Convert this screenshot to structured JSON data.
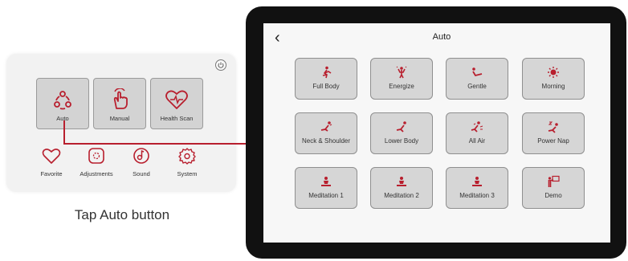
{
  "remote": {
    "buttons": [
      {
        "label": "Auto"
      },
      {
        "label": "Manual"
      },
      {
        "label": "Health Scan"
      }
    ],
    "icons": [
      {
        "label": "Favorite"
      },
      {
        "label": "Adjustments"
      },
      {
        "label": "Sound"
      },
      {
        "label": "System"
      }
    ],
    "caption": "Tap Auto button"
  },
  "tablet": {
    "back_glyph": "‹",
    "title": "Auto",
    "tiles": [
      {
        "label": "Full Body"
      },
      {
        "label": "Energize"
      },
      {
        "label": "Gentle"
      },
      {
        "label": "Morning"
      },
      {
        "label": "Neck & Shoulder"
      },
      {
        "label": "Lower Body"
      },
      {
        "label": "All Air"
      },
      {
        "label": "Power Nap"
      },
      {
        "label": "Meditation 1"
      },
      {
        "label": "Meditation 2"
      },
      {
        "label": "Meditation 3"
      },
      {
        "label": "Demo"
      }
    ]
  },
  "colors": {
    "accent": "#b81f2e",
    "tile_bg": "#d6d6d6",
    "tablet_frame": "#111111"
  }
}
